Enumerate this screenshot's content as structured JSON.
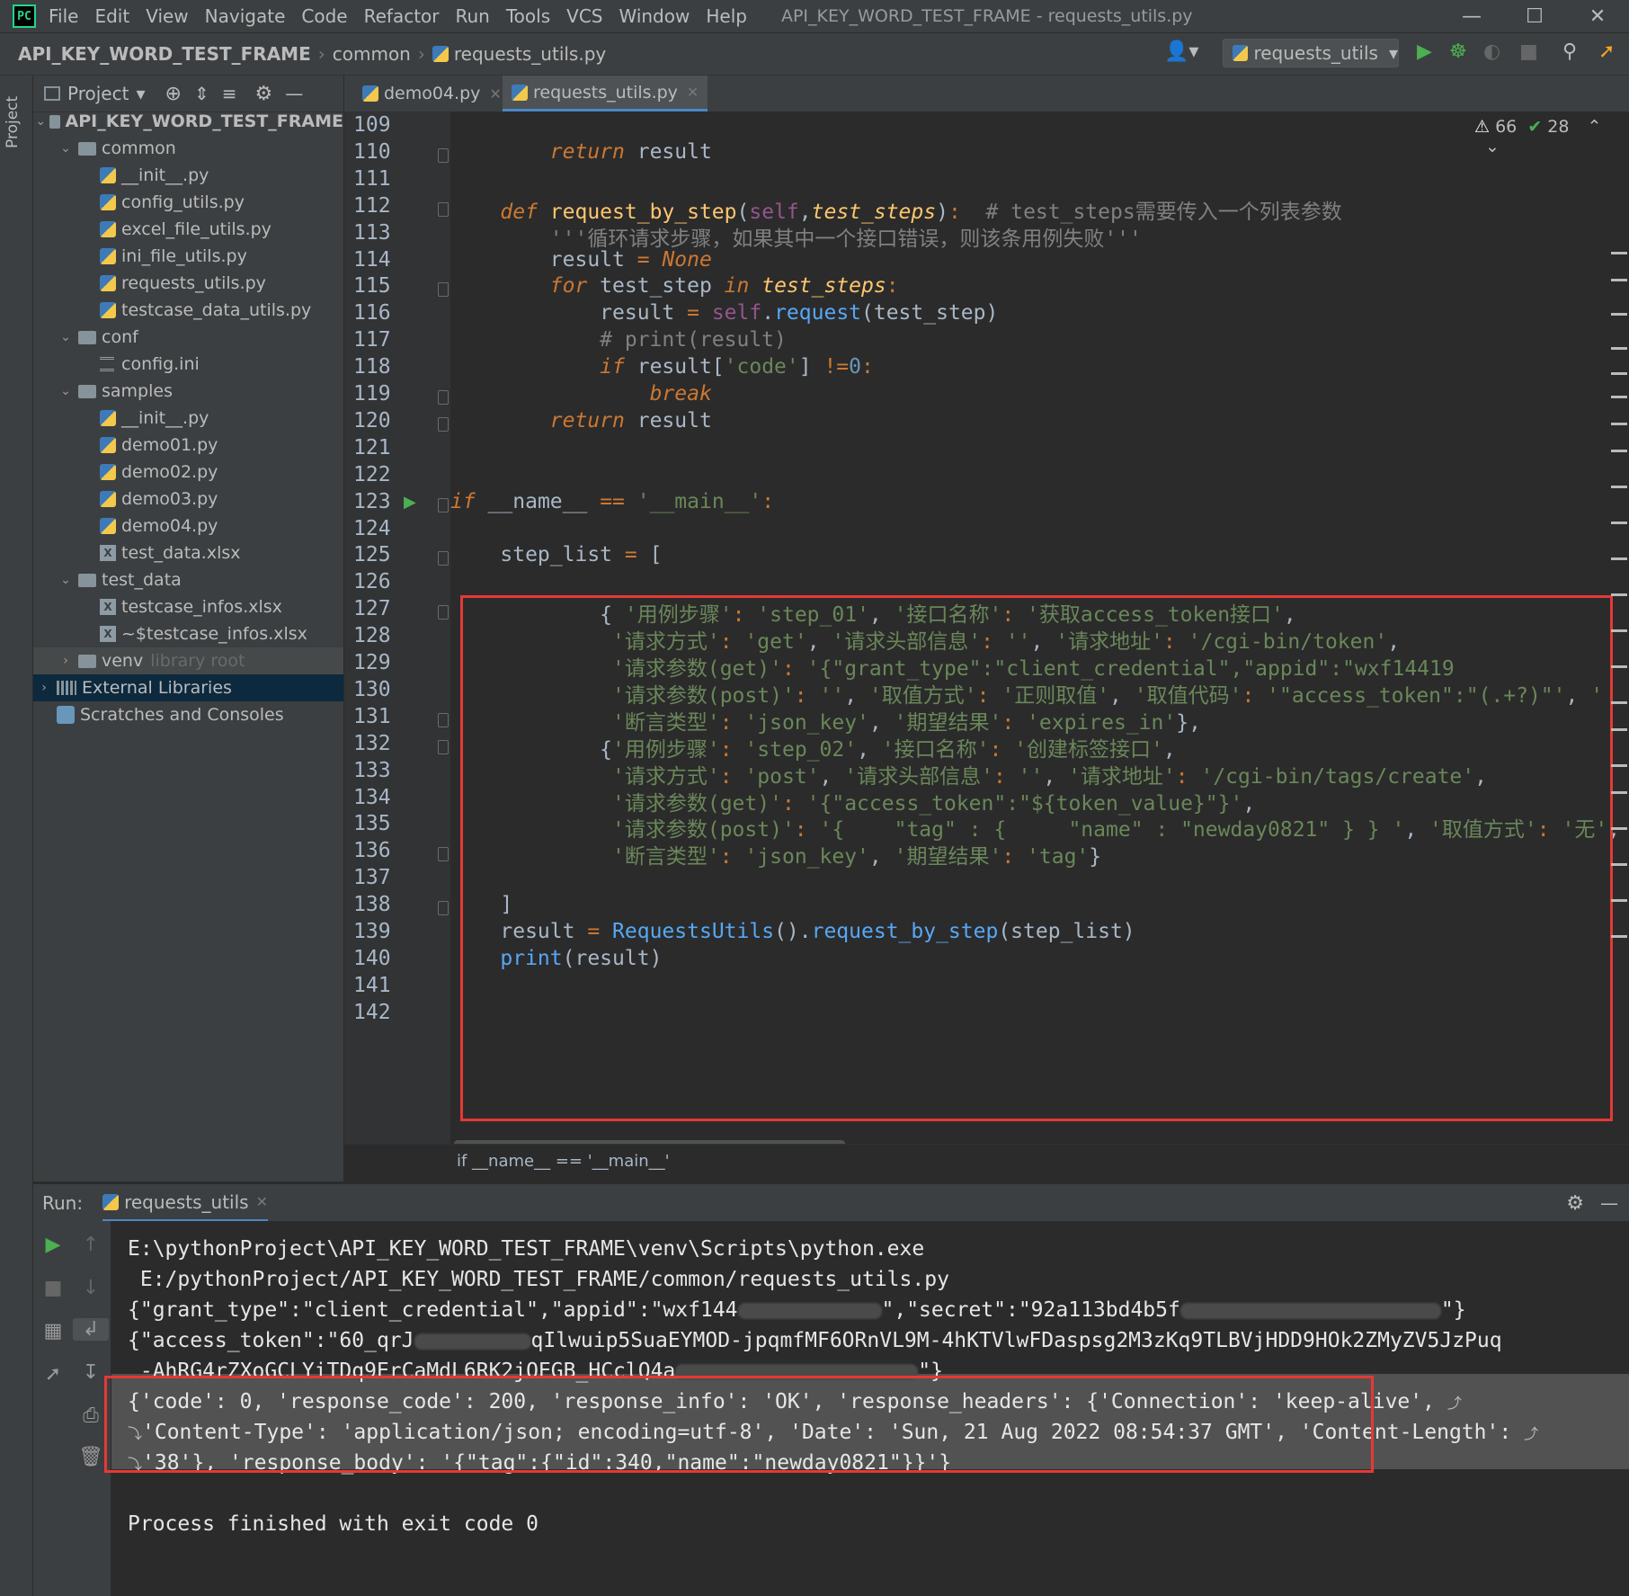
{
  "menubar": {
    "items": [
      "File",
      "Edit",
      "View",
      "Navigate",
      "Code",
      "Refactor",
      "Run",
      "Tools",
      "VCS",
      "Window",
      "Help"
    ],
    "window_title": "API_KEY_WORD_TEST_FRAME - requests_utils.py"
  },
  "breadcrumb": {
    "project": "API_KEY_WORD_TEST_FRAME",
    "folder": "common",
    "file": "requests_utils.py"
  },
  "run_config": {
    "label": "requests_utils"
  },
  "project_panel": {
    "tab": "Project",
    "header": "Project",
    "tree": [
      {
        "label": "API_KEY_WORD_TEST_FRAME",
        "kind": "folder",
        "level": 0,
        "expanded": true,
        "bold": true
      },
      {
        "label": "common",
        "kind": "folder",
        "level": 1,
        "expanded": true
      },
      {
        "label": "__init__.py",
        "kind": "py",
        "level": 2
      },
      {
        "label": "config_utils.py",
        "kind": "py",
        "level": 2
      },
      {
        "label": "excel_file_utils.py",
        "kind": "py",
        "level": 2
      },
      {
        "label": "ini_file_utils.py",
        "kind": "py",
        "level": 2
      },
      {
        "label": "requests_utils.py",
        "kind": "py",
        "level": 2
      },
      {
        "label": "testcase_data_utils.py",
        "kind": "py",
        "level": 2
      },
      {
        "label": "conf",
        "kind": "folder",
        "level": 1,
        "expanded": true
      },
      {
        "label": "config.ini",
        "kind": "ini",
        "level": 2
      },
      {
        "label": "samples",
        "kind": "folder",
        "level": 1,
        "expanded": true
      },
      {
        "label": "__init__.py",
        "kind": "py",
        "level": 2
      },
      {
        "label": "demo01.py",
        "kind": "py",
        "level": 2
      },
      {
        "label": "demo02.py",
        "kind": "py",
        "level": 2
      },
      {
        "label": "demo03.py",
        "kind": "py",
        "level": 2
      },
      {
        "label": "demo04.py",
        "kind": "py",
        "level": 2
      },
      {
        "label": "test_data.xlsx",
        "kind": "xls",
        "level": 2
      },
      {
        "label": "test_data",
        "kind": "folder",
        "level": 1,
        "expanded": true
      },
      {
        "label": "testcase_infos.xlsx",
        "kind": "xls",
        "level": 2
      },
      {
        "label": "~$testcase_infos.xlsx",
        "kind": "xls",
        "level": 2
      },
      {
        "label": "venv",
        "kind": "folder",
        "level": 1,
        "expanded": false,
        "suffix": "library root",
        "highlight": true
      },
      {
        "label": "External Libraries",
        "kind": "lib",
        "level": 0,
        "expanded": false,
        "selected": true
      },
      {
        "label": "Scratches and Consoles",
        "kind": "scratch",
        "level": 0
      }
    ]
  },
  "editor": {
    "tabs": [
      {
        "label": "demo04.py",
        "active": false
      },
      {
        "label": "requests_utils.py",
        "active": true
      }
    ],
    "inspection": {
      "warnings": "66",
      "ok": "28"
    },
    "current_line": "124",
    "footer_crumb": "if __name__ == '__main__'",
    "lines": [
      {
        "n": "109",
        "html": ""
      },
      {
        "n": "110",
        "html": "        <span class='k'>return</span> result"
      },
      {
        "n": "111",
        "html": ""
      },
      {
        "n": "112",
        "html": "    <span class='k'>def</span> <span class='fn'>request_by_step</span>(<span class='self'>self</span>,<span class='it-param'>test_steps</span>)<span class='kp'>:</span>  <span class='cm'># test_steps需要传入一个列表参数</span>"
      },
      {
        "n": "113",
        "html": "        <span class='cm'>'''循环请求步骤，如果其中一个接口错误，则该条用例失败'''</span>"
      },
      {
        "n": "114",
        "html": "        result <span class='kp'>=</span> <span class='k'>None</span>"
      },
      {
        "n": "115",
        "html": "        <span class='k'>for</span> test_step <span class='k'>in</span> <span class='it-param'>test_steps</span><span class='kp'>:</span>"
      },
      {
        "n": "116",
        "html": "            result <span class='kp'>=</span> <span class='self'>self</span>.<span class='call'>request</span>(test_step)"
      },
      {
        "n": "117",
        "html": "            <span class='cm'># print(result)</span>"
      },
      {
        "n": "118",
        "html": "            <span class='k'>if</span> result[<span class='s'>'code'</span>] <span class='kp'>!=</span><span class='num'>0</span><span class='kp'>:</span>"
      },
      {
        "n": "119",
        "html": "                <span class='k'>break</span>"
      },
      {
        "n": "120",
        "html": "        <span class='k'>return</span> result"
      },
      {
        "n": "121",
        "html": ""
      },
      {
        "n": "122",
        "html": ""
      },
      {
        "n": "123",
        "html": "<span class='k'>if</span> __name__ <span class='kp'>==</span> <span class='s'>'__main__'</span><span class='kp'>:</span>"
      },
      {
        "n": "124",
        "html": ""
      },
      {
        "n": "125",
        "html": "    step_list <span class='kp'>=</span> ["
      },
      {
        "n": "126",
        "html": ""
      },
      {
        "n": "127",
        "html": "            { <span class='s'>'用例步骤'</span><span class='kp'>:</span> <span class='s'>'step_01'</span>, <span class='s'>'接口名称'</span><span class='kp'>:</span> <span class='s'>'获取access_token接口'</span>,"
      },
      {
        "n": "128",
        "html": "             <span class='s'>'请求方式'</span><span class='kp'>:</span> <span class='s'>'get'</span>, <span class='s'>'请求头部信息'</span><span class='kp'>:</span> <span class='s'>''</span>, <span class='s'>'请求地址'</span><span class='kp'>:</span> <span class='s'>'/cgi-bin/token'</span>,"
      },
      {
        "n": "129",
        "html": "             <span class='s'>'请求参数(get)'</span><span class='kp'>:</span> <span class='s'>'{\"grant_type\":\"client_credential\",\"appid\":\"wxf14419</span>"
      },
      {
        "n": "130",
        "html": "             <span class='s'>'请求参数(post)'</span><span class='kp'>:</span> <span class='s'>''</span>, <span class='s'>'取值方式'</span><span class='kp'>:</span> <span class='s'>'正则取值'</span>, <span class='s'>'取值代码'</span><span class='kp'>:</span> <span class='s'>'\"access_token\":\"(.+?)\"'</span>, <span class='s'>'</span>"
      },
      {
        "n": "131",
        "html": "             <span class='s'>'断言类型'</span><span class='kp'>:</span> <span class='s'>'json_key'</span>, <span class='s'>'期望结果'</span><span class='kp'>:</span> <span class='s'>'expires_in'</span>},"
      },
      {
        "n": "132",
        "html": "            {<span class='s'>'用例步骤'</span><span class='kp'>:</span> <span class='s'>'step_02'</span>, <span class='s'>'接口名称'</span><span class='kp'>:</span> <span class='s'>'创建标签接口'</span>,"
      },
      {
        "n": "133",
        "html": "             <span class='s'>'请求方式'</span><span class='kp'>:</span> <span class='s'>'post'</span>, <span class='s'>'请求头部信息'</span><span class='kp'>:</span> <span class='s'>''</span>, <span class='s'>'请求地址'</span><span class='kp'>:</span> <span class='s'>'/cgi-bin/tags/create'</span>,"
      },
      {
        "n": "134",
        "html": "             <span class='s'>'请求参数(get)'</span><span class='kp'>:</span> <span class='s'>'{\"access_token\":\"${token_value}\"}'</span>,"
      },
      {
        "n": "135",
        "html": "             <span class='s'>'请求参数(post)'</span><span class='kp'>:</span> <span class='s'>'{    \"tag\" : {     \"name\" : \"newday0821\" } } '</span>, <span class='s'>'取值方式'</span><span class='kp'>:</span> <span class='s'>'无'</span>,"
      },
      {
        "n": "136",
        "html": "             <span class='s'>'断言类型'</span><span class='kp'>:</span> <span class='s'>'json_key'</span>, <span class='s'>'期望结果'</span><span class='kp'>:</span> <span class='s'>'tag'</span>}"
      },
      {
        "n": "137",
        "html": ""
      },
      {
        "n": "138",
        "html": "    ]"
      },
      {
        "n": "139",
        "html": "    result <span class='kp'>=</span> <span class='call'>RequestsUtils</span>().<span class='call'>request_by_step</span>(step_list)"
      },
      {
        "n": "140",
        "html": "    <span class='call'>print</span>(result)"
      },
      {
        "n": "141",
        "html": ""
      },
      {
        "n": "142",
        "html": ""
      }
    ]
  },
  "run_panel": {
    "label": "Run:",
    "tab": "requests_utils",
    "console": [
      "E:\\pythonProject\\API_KEY_WORD_TEST_FRAME\\venv\\Scripts\\python.exe",
      " E:/pythonProject/API_KEY_WORD_TEST_FRAME/common/requests_utils.py",
      "{\"grant_type\":\"client_credential\",\"appid\":\"wxf144",
      "\",\"secret\":\"92a113bd4b5f",
      "\"}",
      "{\"access_token\":\"60_qrJ",
      "qIlwuip5SuaEYMOD-jpqmfMF6ORnVL9M-4hKTVlwFDaspsg2M3zKq9TLBVjHDD9HOk2ZMyZV5JzPuq",
      " -AhRG4rZXoGCLYiTDq9ErCaMdL6RK2jOEGB_HCclQ4a",
      "\"}",
      "{'code': 0, 'response_code': 200, 'response_info': 'OK', 'response_headers': {'Connection': 'keep-alive', ",
      "'Content-Type': 'application/json; encoding=utf-8', 'Date': 'Sun, 21 Aug 2022 08:54:37 GMT', 'Content-Length': ",
      "'38'}, 'response_body': '{\"tag\":{\"id\":340,\"name\":\"newday0821\"}}'}",
      "Process finished with exit code 0"
    ]
  },
  "colors": {
    "highlight_box": "#e53935",
    "keyword": "#cc7832",
    "string": "#6a8759",
    "function": "#ffc66d"
  }
}
